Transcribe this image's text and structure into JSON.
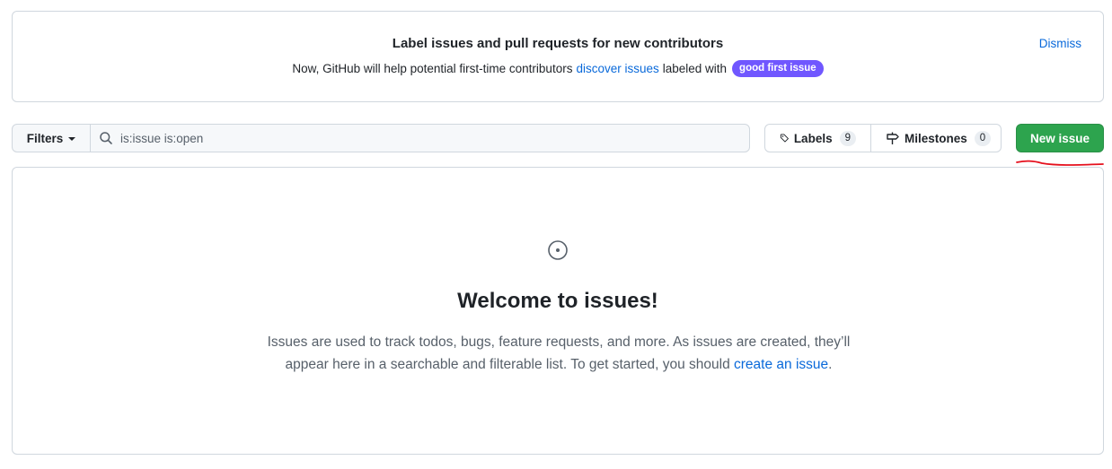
{
  "banner": {
    "title": "Label issues and pull requests for new contributors",
    "text_before": "Now, GitHub will help potential first-time contributors",
    "link_text": "discover issues",
    "text_after": "labeled with",
    "label": "good first issue",
    "dismiss": "Dismiss"
  },
  "toolbar": {
    "filters_label": "Filters",
    "search_value": "is:issue is:open",
    "labels_label": "Labels",
    "labels_count": "9",
    "milestones_label": "Milestones",
    "milestones_count": "0",
    "new_issue_label": "New issue"
  },
  "blankslate": {
    "title": "Welcome to issues!",
    "text_line1": "Issues are used to track todos, bugs, feature requests, and more. As issues are created, they’ll",
    "text_line2": "appear here in a searchable and filterable list. To get started, you should",
    "link_text": "create an issue",
    "text_end": "."
  },
  "colors": {
    "accent_link": "#0969da",
    "primary_button": "#2da44e",
    "good_first_issue_label": "#7057ff",
    "annotation": "#e5101d"
  },
  "icons": [
    "search-icon",
    "tag-icon",
    "milestone-icon",
    "issue-opened-icon",
    "caret-down-icon"
  ]
}
